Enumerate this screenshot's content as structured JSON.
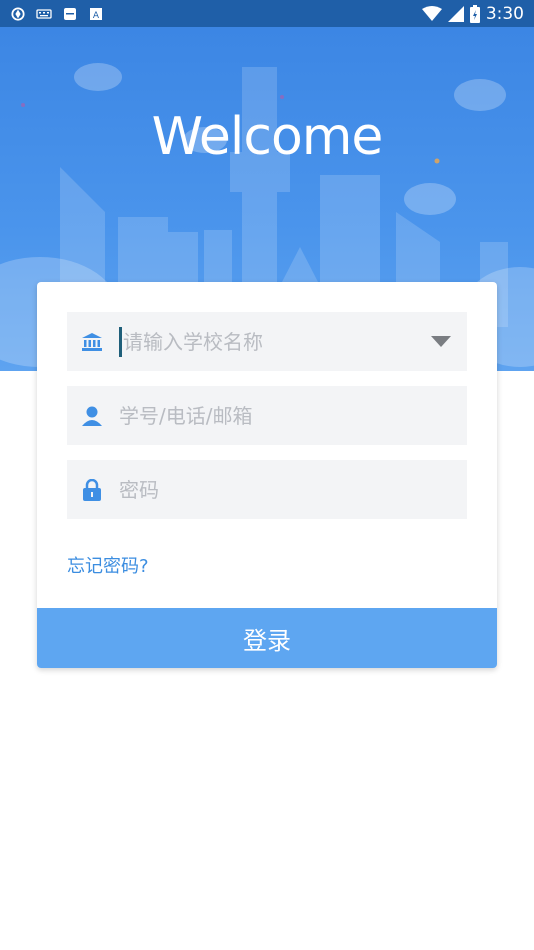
{
  "status_bar": {
    "time": "3:30"
  },
  "hero": {
    "title": "Welcome"
  },
  "form": {
    "school": {
      "placeholder": "请输入学校名称"
    },
    "account": {
      "placeholder": "学号/电话/邮箱"
    },
    "password": {
      "placeholder": "密码"
    },
    "forgot_label": "忘记密码?",
    "login_label": "登录"
  },
  "colors": {
    "primary": "#3c86e4",
    "button": "#5ea6f1",
    "link": "#3b8de0",
    "field_bg": "#f3f4f6"
  }
}
